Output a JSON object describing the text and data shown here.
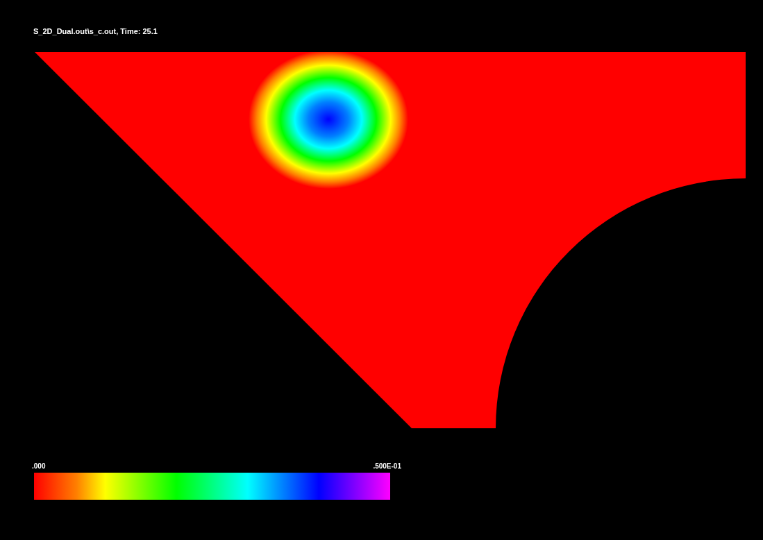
{
  "plot": {
    "title": "S_2D_Dual.out\\s_c.out, Time: 25.1"
  },
  "legend": {
    "min_label": ".000",
    "max_label": ".500E-01"
  }
}
